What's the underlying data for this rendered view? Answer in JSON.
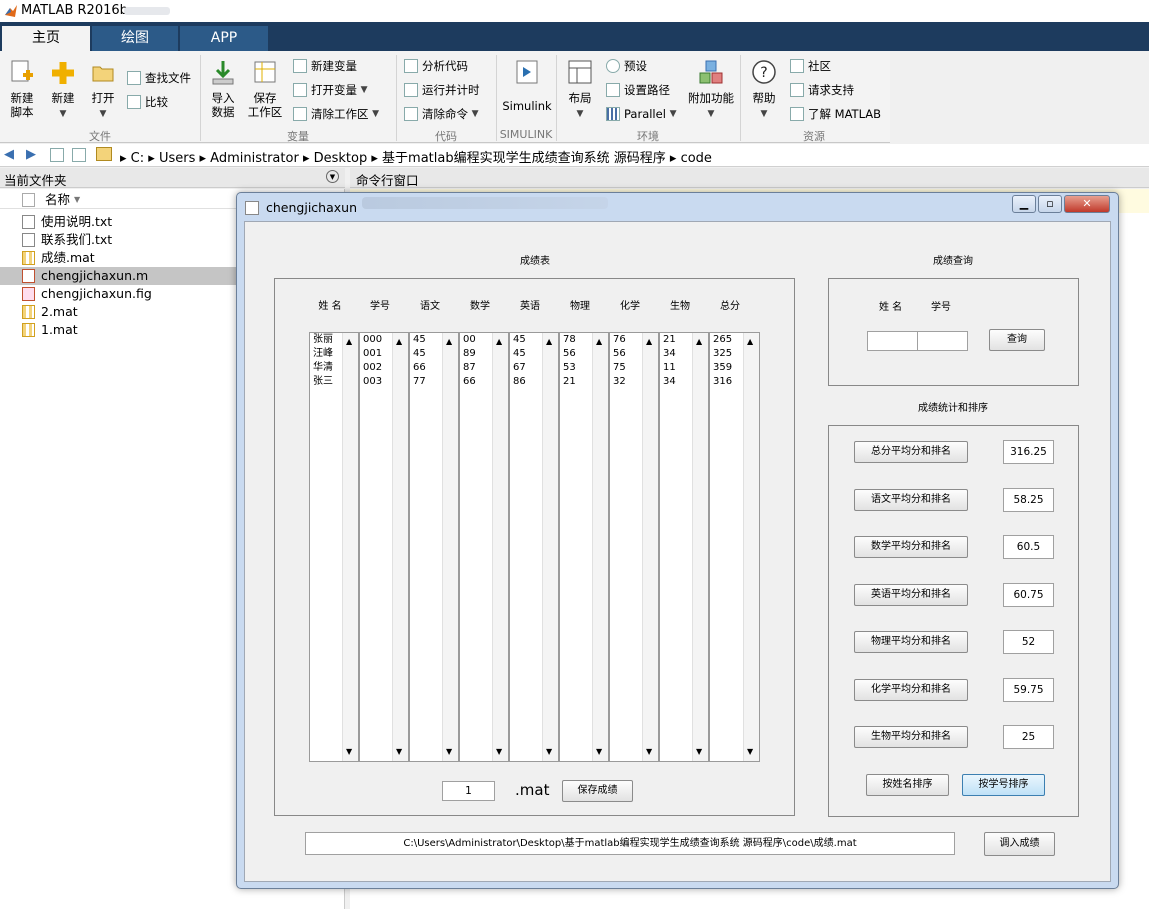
{
  "app": {
    "title": "MATLAB R2016b"
  },
  "tabs": [
    {
      "label": "主页",
      "active": true
    },
    {
      "label": "绘图",
      "active": false
    },
    {
      "label": "APP",
      "active": false
    }
  ],
  "ribbon": {
    "file": {
      "new_script": "新建\n脚本",
      "new": "新建",
      "open": "打开",
      "find_files": "查找文件",
      "compare": "比较",
      "group": "文件"
    },
    "variable": {
      "import": "导入\n数据",
      "save_ws": "保存\n工作区",
      "new_var": "新建变量",
      "open_var": "打开变量",
      "clear_ws": "清除工作区",
      "group": "变量"
    },
    "code": {
      "analyze": "分析代码",
      "run_time": "运行并计时",
      "clear_cmds": "清除命令",
      "group": "代码"
    },
    "simulink": {
      "label": "Simulink",
      "group": "SIMULINK"
    },
    "env": {
      "layout": "布局",
      "prefs": "预设",
      "set_path": "设置路径",
      "parallel": "Parallel",
      "addons": "附加功能",
      "group": "环境"
    },
    "resources": {
      "help": "帮助",
      "community": "社区",
      "support": "请求支持",
      "learn": "了解 MATLAB",
      "group": "资源"
    }
  },
  "address": {
    "path": [
      "C:",
      "Users",
      "Administrator",
      "Desktop",
      "基于matlab编程实现学生成绩查询系统 源码程序",
      "code"
    ]
  },
  "current_folder": {
    "title": "当前文件夹",
    "name_col": "名称",
    "files": [
      {
        "name": "使用说明.txt",
        "type": "txt",
        "selected": false
      },
      {
        "name": "联系我们.txt",
        "type": "txt",
        "selected": false
      },
      {
        "name": "成绩.mat",
        "type": "mat",
        "selected": false
      },
      {
        "name": "chengjichaxun.m",
        "type": "m",
        "selected": true
      },
      {
        "name": "chengjichaxun.fig",
        "type": "fig",
        "selected": false
      },
      {
        "name": "2.mat",
        "type": "mat",
        "selected": false
      },
      {
        "name": "1.mat",
        "type": "mat",
        "selected": false
      }
    ]
  },
  "command_window": {
    "title": "命令行窗口"
  },
  "figure": {
    "title": "chengjichaxun",
    "grade_panel": {
      "title": "成绩表",
      "columns": [
        "姓 名",
        "学号",
        "语文",
        "数学",
        "英语",
        "物理",
        "化学",
        "生物",
        "总分"
      ],
      "lists": [
        "张丽\n汪峰\n华清\n张三",
        "000\n001\n002\n003",
        "45\n45\n66\n77",
        "00\n89\n87\n66",
        "45\n45\n67\n86",
        "78\n56\n53\n21",
        "76\n56\n75\n32",
        "21\n34\n11\n34",
        "265\n325\n359\n316"
      ],
      "file_number": "1",
      "ext_label": ".mat",
      "save_button": "保存成绩"
    },
    "query_panel": {
      "title": "成绩查询",
      "name_label": "姓 名",
      "id_label": "学号",
      "query_button": "查询"
    },
    "stats_panel": {
      "title": "成绩统计和排序",
      "rows": [
        {
          "button": "总分平均分和排名",
          "value": "316.25"
        },
        {
          "button": "语文平均分和排名",
          "value": "58.25"
        },
        {
          "button": "数学平均分和排名",
          "value": "60.5"
        },
        {
          "button": "英语平均分和排名",
          "value": "60.75"
        },
        {
          "button": "物理平均分和排名",
          "value": "52"
        },
        {
          "button": "化学平均分和排名",
          "value": "59.75"
        },
        {
          "button": "生物平均分和排名",
          "value": "25"
        }
      ],
      "sort_name": "按姓名排序",
      "sort_id": "按学号排序"
    },
    "path_value": "C:\\Users\\Administrator\\Desktop\\基于matlab编程实现学生成绩查询系统 源码程序\\code\\成绩.mat",
    "load_button": "调入成绩"
  }
}
